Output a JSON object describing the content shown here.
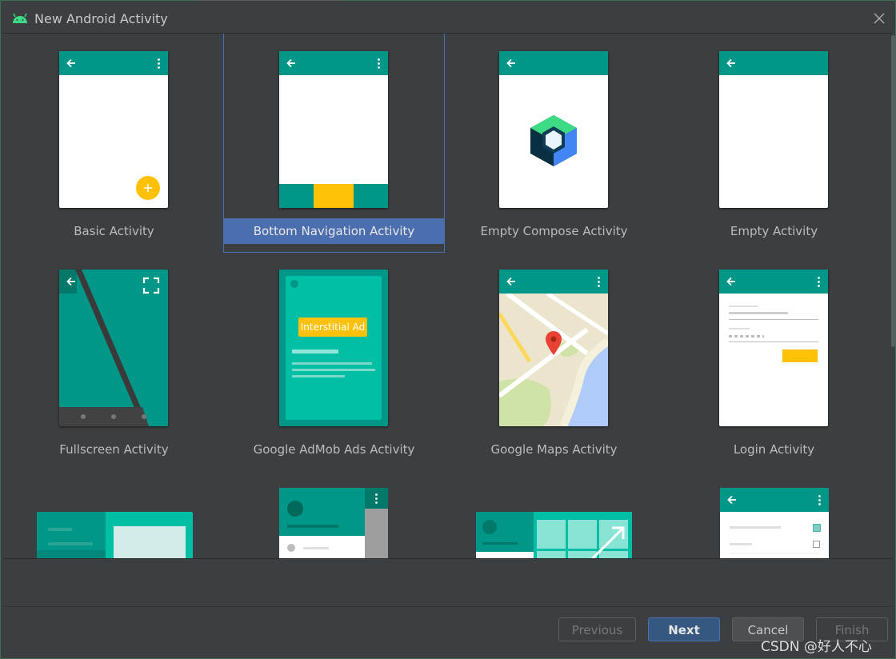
{
  "window": {
    "title": "New Android Activity"
  },
  "templates": [
    {
      "label": "Basic Activity"
    },
    {
      "label": "Bottom Navigation Activity"
    },
    {
      "label": "Empty Compose Activity"
    },
    {
      "label": "Empty Activity"
    },
    {
      "label": "Fullscreen Activity"
    },
    {
      "label": "Google AdMob Ads Activity",
      "ad_badge": "Interstitial Ad"
    },
    {
      "label": "Google Maps Activity"
    },
    {
      "label": "Login Activity"
    }
  ],
  "buttons": {
    "previous": "Previous",
    "next": "Next",
    "cancel": "Cancel",
    "finish": "Finish"
  },
  "watermark": "CSDN @好人不心",
  "colors": {
    "accent": "#009688",
    "selection": "#4b6eaf",
    "fab": "#ffc107"
  }
}
